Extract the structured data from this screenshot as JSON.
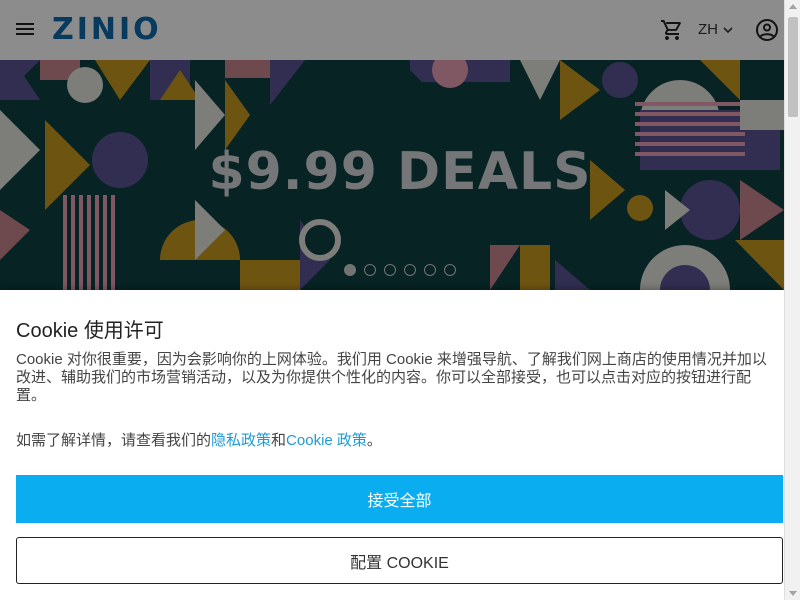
{
  "header": {
    "menu_icon": "hamburger-menu-icon",
    "logo": "ZINIO",
    "cart_icon": "shopping-cart-icon",
    "language": "ZH",
    "language_icon": "chevron-down-icon",
    "account_icon": "account-circle-icon"
  },
  "banner": {
    "title": "$9.99 DEALS",
    "slide_count": 6,
    "active_slide": 1
  },
  "cookie": {
    "title": "Cookie 使用许可",
    "body": "Cookie 对你很重要，因为会影响你的上网体验。我们用 Cookie 来增强导航、了解我们网上商店的使用情况并加以改进、辅助我们的市场营销活动，以及为你提供个性化的内容。你可以全部接受，也可以点击对应的按钮进行配置。",
    "details_prefix": "如需了解详情，请查看我们的",
    "privacy_link": "隐私政策",
    "and": "和",
    "cookie_policy_link": "Cookie 政策",
    "suffix": "。",
    "accept_all": "接受全部",
    "configure": "配置 COOKIE"
  },
  "colors": {
    "brand": "#0e6ba8",
    "accept_button": "#0aaef0",
    "link": "#1e9bd7",
    "banner_bg": "#0f4043"
  }
}
